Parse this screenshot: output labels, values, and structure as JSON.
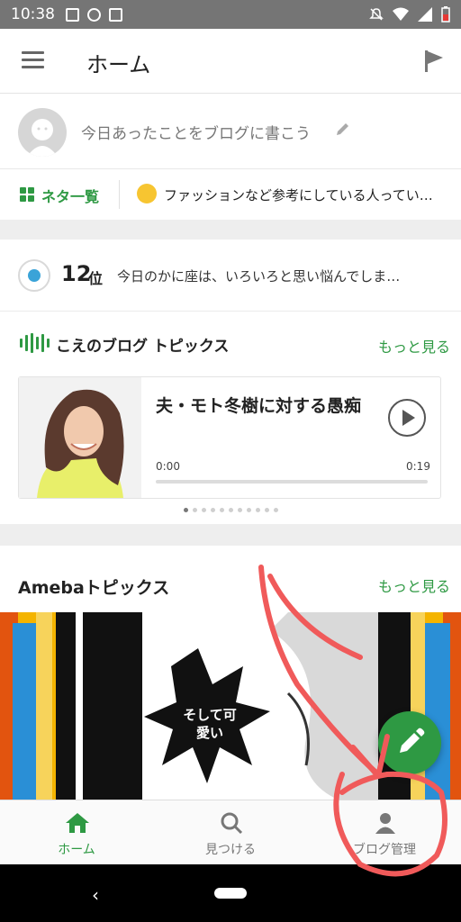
{
  "status_bar": {
    "time": "10:38"
  },
  "app_bar": {
    "title": "ホーム"
  },
  "compose": {
    "prompt": "今日あったことをブログに書こう"
  },
  "neta": {
    "label": "ネタ一覧",
    "topic": "ファッションなど参考にしている人ってい…"
  },
  "ranking": {
    "rank": "12",
    "unit": "位",
    "text": "今日のかに座は、いろいろと思い悩んでしま…"
  },
  "voice_blog": {
    "title": "こえのブログ トピックス",
    "more": "もっと見る",
    "card": {
      "title": "夫・モト冬樹に対する愚痴",
      "time_start": "0:00",
      "time_end": "0:19",
      "progress": 0.0
    }
  },
  "ameba_topics": {
    "title": "Amebaトピックス",
    "more": "もっと見る",
    "banner_text": "そして可愛い"
  },
  "bottom_nav": {
    "items": [
      {
        "label": "ホーム",
        "icon": "home-icon",
        "active": true
      },
      {
        "label": "見つける",
        "icon": "search-icon",
        "active": false
      },
      {
        "label": "ブログ管理",
        "icon": "person-icon",
        "active": false
      }
    ]
  },
  "colors": {
    "accent": "#2e9943",
    "status_bar": "#757575",
    "annotation": "#f05a5a"
  }
}
